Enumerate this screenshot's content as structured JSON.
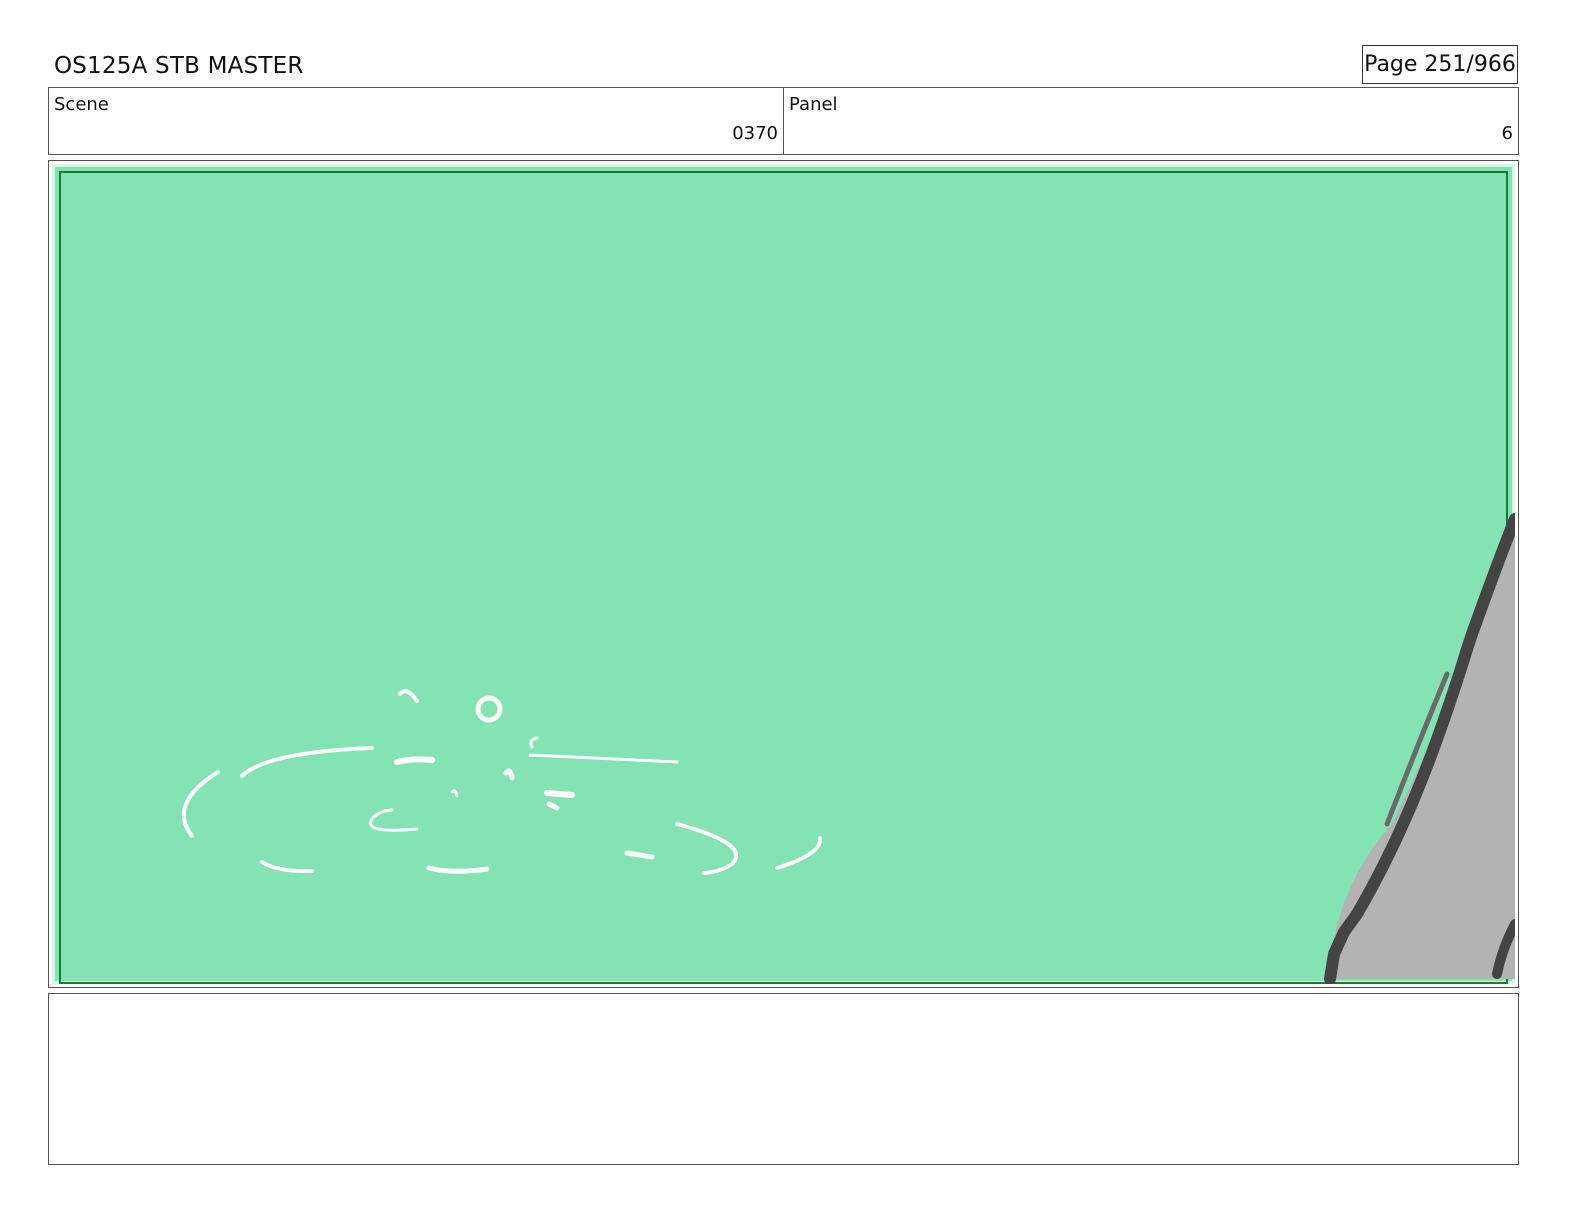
{
  "document": {
    "title": "OS125A STB MASTER",
    "page": "Page 251/966"
  },
  "info": {
    "scene_label": "Scene",
    "scene_value": "0370",
    "panel_label": "Panel",
    "panel_value": "6"
  },
  "colors": {
    "frame_fill": "#84e3b3",
    "frame_border": "#1a7a2e",
    "rock_fill": "#b3b3b3",
    "rock_outline": "#444444",
    "splash": "#ffffff"
  },
  "notes": {
    "text": ""
  }
}
